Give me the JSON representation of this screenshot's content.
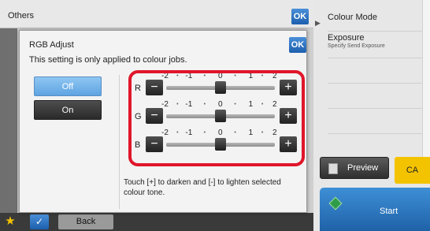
{
  "right_panel": {
    "items": [
      {
        "label": "Colour Mode",
        "sub": ""
      },
      {
        "label": "Exposure",
        "sub": "Specify Send Exposure"
      }
    ],
    "preview_label": "Preview",
    "ca_label": "CA",
    "start_label": "Start"
  },
  "others": {
    "title": "Others",
    "ok_label": "OK",
    "back_label": "Back"
  },
  "dialog": {
    "title": "RGB Adjust",
    "ok_label": "OK",
    "note": "This setting is only applied to colour jobs.",
    "off_label": "Off",
    "on_label": "On",
    "selected": "Off",
    "hint": "Touch [+] to darken and [-] to lighten selected colour tone."
  },
  "sliders": {
    "scale": [
      "-2",
      "-1",
      "0",
      "1",
      "2"
    ],
    "range": [
      -2,
      2
    ],
    "channels": [
      {
        "letter": "R",
        "value": 0
      },
      {
        "letter": "G",
        "value": 0
      },
      {
        "letter": "B",
        "value": 0
      }
    ],
    "minus_label": "−",
    "plus_label": "+"
  },
  "colors": {
    "highlight": "#e0162b",
    "accent_blue": "#1c5fae",
    "ca_yellow": "#f4c300"
  }
}
